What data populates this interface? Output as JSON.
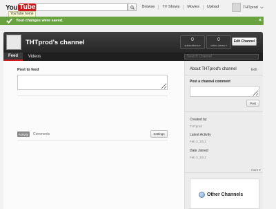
{
  "masthead": {
    "logo_you": "You",
    "logo_tube": "Tube",
    "home_tooltip": "YouTube home",
    "search_value": "",
    "nav": [
      "Browse",
      "TV Shows",
      "Movies",
      "Upload"
    ],
    "user_name": "THTprod"
  },
  "alert": {
    "message": "Your changes were saved.",
    "color": "#69a340"
  },
  "channel": {
    "title": "THTprod's channel",
    "subscribers": {
      "count": "0",
      "label": "subscribers"
    },
    "video_views": {
      "count": "0",
      "label": "video views"
    },
    "edit_button": "Edit Channel",
    "tabs": [
      "Feed",
      "Videos"
    ],
    "search_placeholder": "Search Channel"
  },
  "feed": {
    "post_label": "Post to feed",
    "filter_activity": "Activity",
    "filter_comments": "Comments",
    "settings_button": "Settings"
  },
  "about": {
    "title": "About THTprod's channel",
    "edit": "Edit",
    "comment_label": "Post a channel comment",
    "post_button": "Post",
    "created_by_label": "Created by",
    "created_by_value": "THTprod",
    "latest_activity_label": "Latest Activity",
    "latest_activity_value": "Feb 3, 2012",
    "date_joined_label": "Date Joined",
    "date_joined_value": "Feb 3, 2012",
    "more": "more",
    "other_channels": "Other Channels"
  },
  "colors": {
    "brand_red": "#cc181e",
    "header_dark": "#2b2b2b"
  }
}
